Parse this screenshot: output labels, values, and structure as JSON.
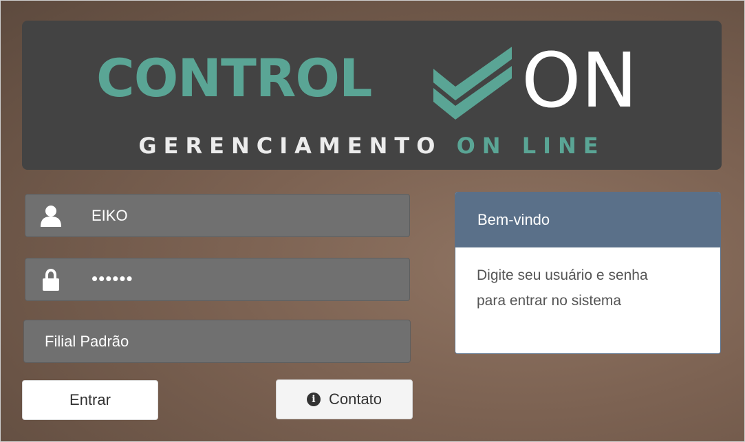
{
  "banner": {
    "logo_left": "CONTROL",
    "logo_right": "ON",
    "tagline_main": "GERENCIAMENTO",
    "tagline_accent": "ON LINE",
    "accent_color": "#5aa595"
  },
  "form": {
    "username_value": "EIKO",
    "password_value": "••••••",
    "filial_value": "Filial Padrão",
    "icons": {
      "user": "user-icon",
      "password": "lock-icon"
    }
  },
  "buttons": {
    "enter_label": "Entrar",
    "contact_label": "Contato",
    "contact_icon": "info-icon"
  },
  "welcome": {
    "title": "Bem-vindo",
    "line1": "Digite seu usuário e senha",
    "line2": "para entrar no sistema",
    "header_color": "#5a7089"
  }
}
